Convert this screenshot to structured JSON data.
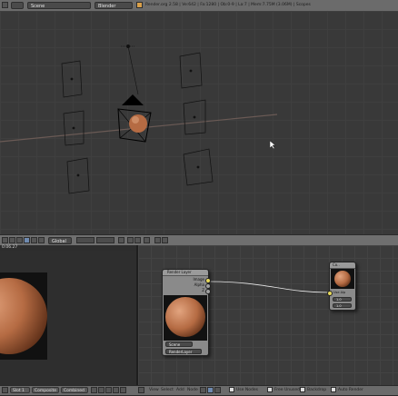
{
  "top_header": {
    "scene_value": "Scene",
    "render_engine": "Blender Render",
    "stats": "Render.org 2.58 | Ve:642 | Fa:1280 | Ob:0-9 | La:7 | Mem:7.75M (3.06M) | Scopes"
  },
  "viewport_header": {
    "mode": "Global"
  },
  "timeline": {
    "frame_label": "0:06.27"
  },
  "nodes": {
    "render_layer": {
      "title": "Render Layer",
      "outputs": [
        "Image",
        "Alpha",
        "Z"
      ],
      "scene_label": "Scene",
      "layer_label": "RenderLayer"
    },
    "composite": {
      "title": "Co..",
      "use_alpha_label": "Use Alp",
      "alpha_field": "1.0",
      "z_field": "1.0"
    }
  },
  "bottom_bar": {
    "slot_label": "Slot 1",
    "composite_label": "Composite",
    "combined_label": "Combined",
    "view_menu": "View",
    "select_menu": "Select",
    "add_menu": "Add",
    "node_menu": "Node",
    "use_nodes_label": "Use Nodes",
    "free_unused_label": "Free Unused",
    "backdrop_label": "Backdrop",
    "auto_render_label": "Auto Render"
  },
  "colors": {
    "sphere": "#b56b43",
    "header_bg": "#6b6b6b",
    "viewport_bg": "#393939",
    "accent": "#e6c25a"
  }
}
